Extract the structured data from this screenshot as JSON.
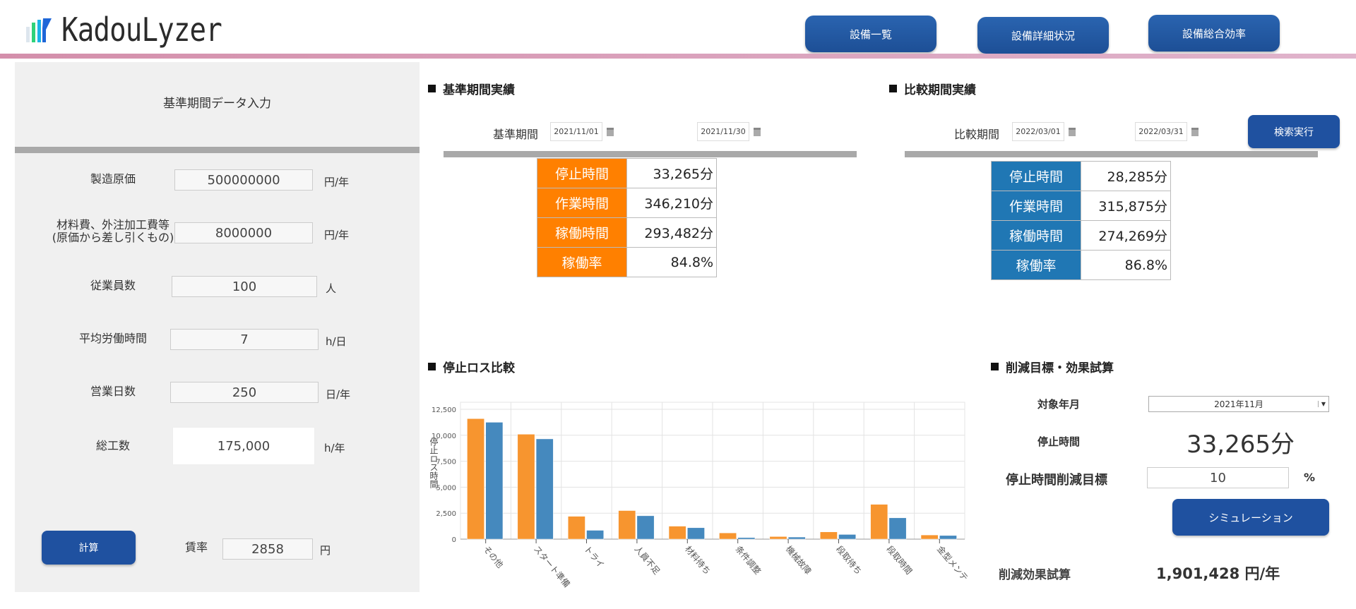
{
  "app": {
    "logo_text": "KadouLyzer"
  },
  "nav": {
    "items": [
      {
        "label": "設備一覧"
      },
      {
        "label": "設備詳細状況"
      },
      {
        "label": "設備総合効率"
      }
    ]
  },
  "colors": {
    "base": "#ff8000",
    "compare": "#2077b4",
    "chart_base": "#f7952f",
    "chart_compare": "#4589be",
    "button": "#1f51a0"
  },
  "input_panel": {
    "title": "基準期間データ入力",
    "fields": [
      {
        "label": "製造原価",
        "value": "500000000",
        "unit": "円/年"
      },
      {
        "label": "材料費、外注加工費等\n(原価から差し引くもの)",
        "value": "8000000",
        "unit": "円/年"
      },
      {
        "label": "従業員数",
        "value": "100",
        "unit": "人"
      },
      {
        "label": "平均労働時間",
        "value": "7",
        "unit": "h/日"
      },
      {
        "label": "営業日数",
        "value": "250",
        "unit": "日/年"
      },
      {
        "label": "総工数",
        "value": "175,000",
        "unit": "h/年"
      }
    ],
    "calc_button": "計算",
    "rate_label": "賃率",
    "rate_value": "2858",
    "rate_unit": "円"
  },
  "base": {
    "title": "基準期間実績",
    "period_label": "基準期間",
    "from": "2021/11/01",
    "to": "2021/11/30",
    "rows": [
      {
        "k": "停止時間",
        "v": "33,265分"
      },
      {
        "k": "作業時間",
        "v": "346,210分"
      },
      {
        "k": "稼働時間",
        "v": "293,482分"
      },
      {
        "k": "稼働率",
        "v": "84.8%"
      }
    ]
  },
  "compare": {
    "title": "比較期間実績",
    "period_label": "比較期間",
    "from": "2022/03/01",
    "to": "2022/03/31",
    "search_button": "検索実行",
    "rows": [
      {
        "k": "停止時間",
        "v": "28,285分"
      },
      {
        "k": "作業時間",
        "v": "315,875分"
      },
      {
        "k": "稼働時間",
        "v": "274,269分"
      },
      {
        "k": "稼働率",
        "v": "86.8%"
      }
    ]
  },
  "chart_section": {
    "title": "停止ロス比較"
  },
  "chart_data": {
    "type": "bar",
    "ylabel": "停止ロス時間",
    "ylim": [
      0,
      12500
    ],
    "grid": true,
    "yticks": [
      "0",
      "2,500",
      "5,000",
      "7,500",
      "10,000",
      "12,500"
    ],
    "categories": [
      "その他",
      "スタート準備",
      "トライ",
      "人員不足",
      "材料待ち",
      "条件調整",
      "機械故障",
      "段取待ち",
      "段取時間",
      "金型メンテ"
    ],
    "series": [
      {
        "values": [
          11600,
          10100,
          2200,
          2750,
          1250,
          600,
          250,
          700,
          3350,
          400
        ]
      },
      {
        "values": [
          11250,
          9650,
          850,
          2250,
          1100,
          150,
          200,
          450,
          2050,
          350
        ]
      }
    ]
  },
  "simulation": {
    "title": "削減目標・効果試算",
    "month_label": "対象年月",
    "month_value": "2021年11月",
    "stop_label": "停止時間",
    "stop_value": "33,265分",
    "target_label": "停止時間削減目標",
    "target_value": "10",
    "target_unit": "%",
    "sim_button": "シミュレーション",
    "effect_label": "削減効果試算",
    "effect_value": "1,901,428 円/年"
  }
}
